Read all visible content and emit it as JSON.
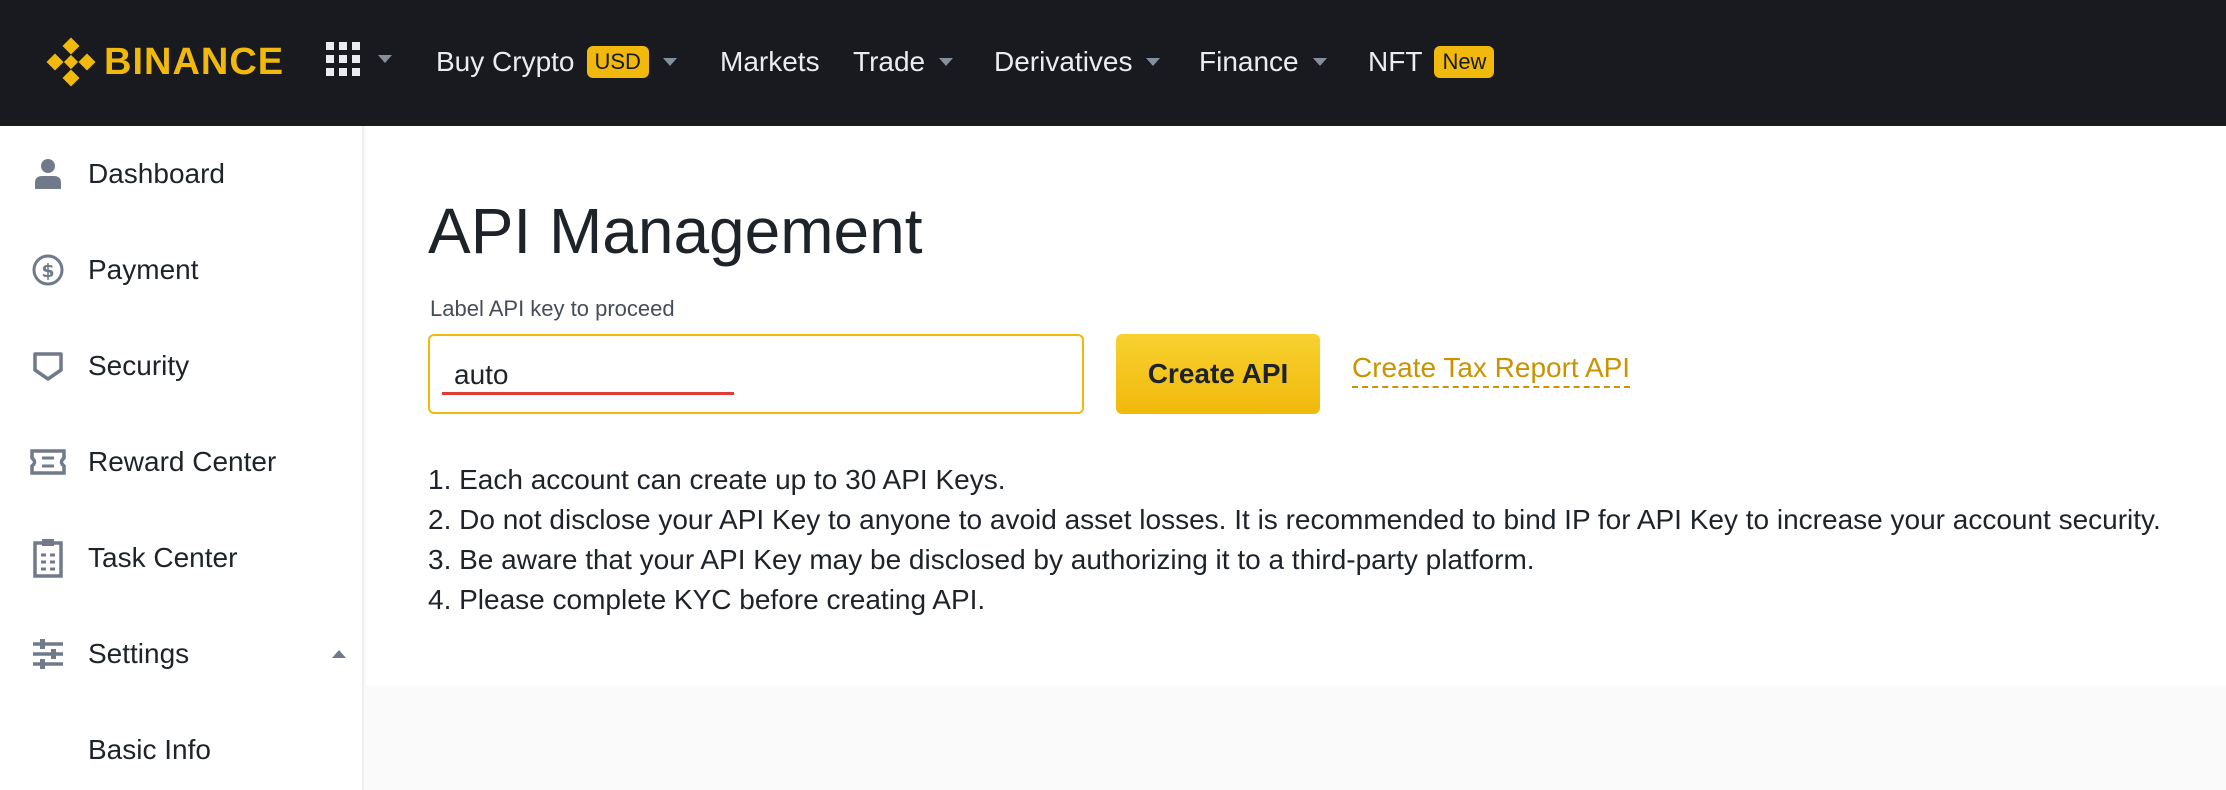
{
  "brand": {
    "name": "BINANCE",
    "color": "#f0b90b",
    "logo_icon": "binance-diamond-icon"
  },
  "topnav": {
    "apps_icon": "grid-icon",
    "items": [
      {
        "label": "Buy Crypto",
        "badge": "USD",
        "has_dropdown": true
      },
      {
        "label": "Markets",
        "has_dropdown": false
      },
      {
        "label": "Trade",
        "has_dropdown": true
      },
      {
        "label": "Derivatives",
        "has_dropdown": true
      },
      {
        "label": "Finance",
        "has_dropdown": true
      },
      {
        "label": "NFT",
        "badge": "New",
        "has_dropdown": false
      }
    ]
  },
  "sidebar": {
    "items": [
      {
        "label": "Dashboard",
        "icon": "user-icon"
      },
      {
        "label": "Payment",
        "icon": "dollar-circle-icon"
      },
      {
        "label": "Security",
        "icon": "shield-icon"
      },
      {
        "label": "Reward Center",
        "icon": "ticket-icon"
      },
      {
        "label": "Task Center",
        "icon": "clipboard-icon"
      },
      {
        "label": "Settings",
        "icon": "sliders-icon",
        "expanded": true
      },
      {
        "label": "Basic Info",
        "icon": ""
      }
    ]
  },
  "main": {
    "title": "API Management",
    "field_label": "Label API key to proceed",
    "input_value": "auto",
    "create_button": "Create API",
    "tax_link": "Create Tax Report API",
    "notes": [
      "1. Each account can create up to 30 API Keys.",
      "2. Do not disclose your API Key to anyone to avoid asset losses. It is recommended to bind IP for API Key to increase your account security.",
      "3. Be aware that your API Key may be disclosed by authorizing it to a third-party platform.",
      "4. Please complete KYC before creating API."
    ]
  },
  "colors": {
    "nav_bg": "#181a20",
    "accent": "#f0b90b",
    "link": "#c99400",
    "text": "#1e2329"
  }
}
